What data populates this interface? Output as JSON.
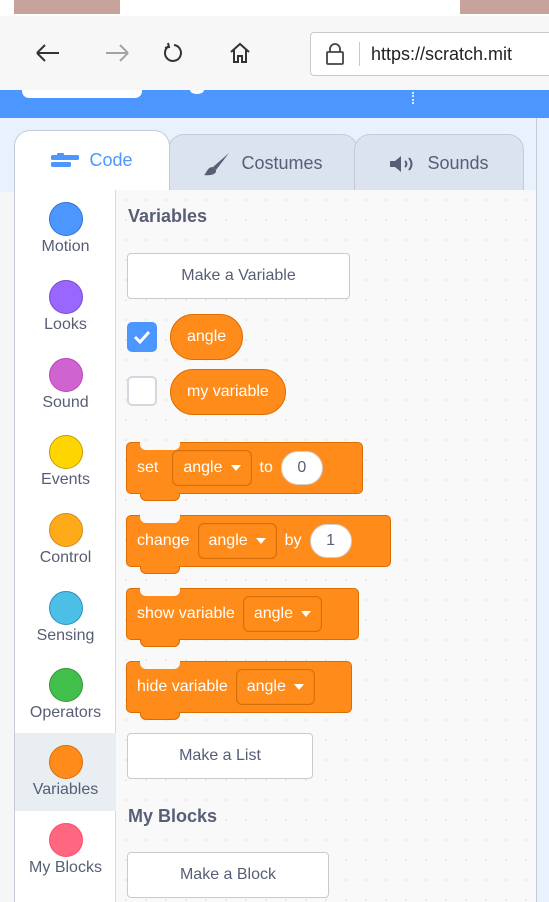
{
  "browser": {
    "url": "https://scratch.mit",
    "back_icon": "arrow-left",
    "forward_icon": "arrow-right",
    "refresh_icon": "refresh",
    "home_icon": "home",
    "lock_icon": "lock"
  },
  "tabs": [
    {
      "label": "Code",
      "icon": "code-icon",
      "active": true
    },
    {
      "label": "Costumes",
      "icon": "brush-icon",
      "active": false
    },
    {
      "label": "Sounds",
      "icon": "speaker-icon",
      "active": false
    }
  ],
  "categories": [
    {
      "label": "Motion",
      "color": "#4c97ff"
    },
    {
      "label": "Looks",
      "color": "#9966ff"
    },
    {
      "label": "Sound",
      "color": "#cf63cf"
    },
    {
      "label": "Events",
      "color": "#ffd500"
    },
    {
      "label": "Control",
      "color": "#ffab19"
    },
    {
      "label": "Sensing",
      "color": "#4cbfe6"
    },
    {
      "label": "Operators",
      "color": "#40bf4a"
    },
    {
      "label": "Variables",
      "color": "#ff8c1a",
      "selected": true
    },
    {
      "label": "My Blocks",
      "color": "#ff6680"
    }
  ],
  "palette": {
    "variables_heading": "Variables",
    "make_variable": "Make a Variable",
    "variables": [
      {
        "name": "angle",
        "checked": true
      },
      {
        "name": "my variable",
        "checked": false
      }
    ],
    "blocks": {
      "set": {
        "label": "set",
        "variable": "angle",
        "joiner": "to",
        "value": "0"
      },
      "change": {
        "label": "change",
        "variable": "angle",
        "joiner": "by",
        "value": "1"
      },
      "show": {
        "label": "show variable",
        "variable": "angle"
      },
      "hide": {
        "label": "hide variable",
        "variable": "angle"
      }
    },
    "make_list": "Make a List",
    "my_blocks_heading": "My Blocks",
    "make_block": "Make a Block"
  },
  "colors": {
    "accent": "#4c97ff",
    "variables": "#ff8c1a"
  }
}
